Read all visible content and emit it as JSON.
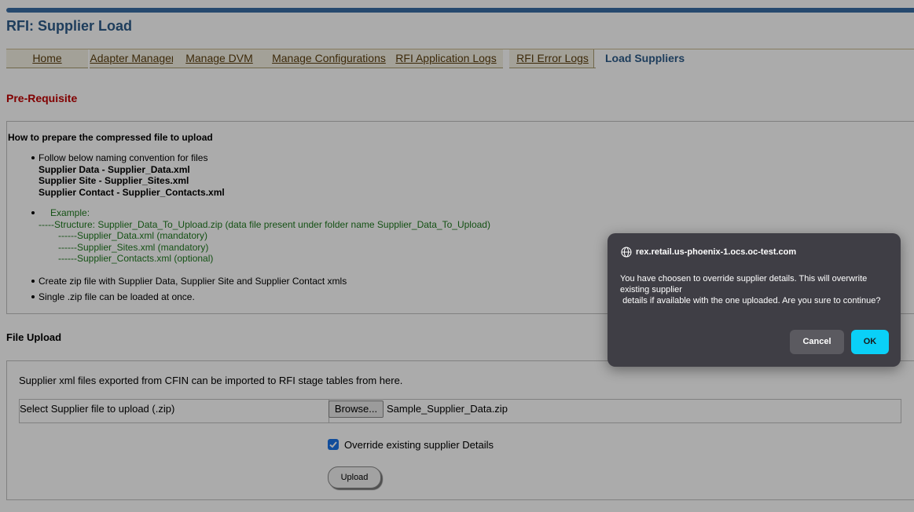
{
  "page": {
    "title": "RFI: Supplier Load"
  },
  "tabs": [
    {
      "label": "Home"
    },
    {
      "label": "Adapter Manager"
    },
    {
      "label": "Manage DVM"
    },
    {
      "label": "Manage Configurations"
    },
    {
      "label": "RFI Application Logs"
    },
    {
      "label": "RFI Error Logs"
    },
    {
      "label": "Load Suppliers",
      "active": true
    }
  ],
  "prereq": {
    "heading": "Pre-Requisite",
    "howto_title": "How to prepare the compressed file to upload",
    "naming_intro": "Follow below naming convention for files",
    "naming": [
      "Supplier Data - Supplier_Data.xml",
      "Supplier Site - Supplier_Sites.xml",
      "Supplier Contact - Supplier_Contacts.xml"
    ],
    "example_label": "Example:",
    "example_lines": [
      "-----Structure: Supplier_Data_To_Upload.zip (data file present under folder name Supplier_Data_To_Upload)",
      "------Supplier_Data.xml (mandatory)",
      "------Supplier_Sites.xml (mandatory)",
      "------Supplier_Contacts.xml (optional)"
    ],
    "bullet_zip": "Create zip file with Supplier Data, Supplier Site and Supplier Contact xmls",
    "bullet_single": "Single .zip file can be loaded at once."
  },
  "upload": {
    "heading": "File Upload",
    "intro": "Supplier xml files exported from CFIN can be imported to RFI stage tables from here.",
    "file_label": "Select Supplier file to upload (.zip)",
    "browse_label": "Browse...",
    "file_name": "Sample_Supplier_Data.zip",
    "override_label": "Override existing supplier Details",
    "override_checked": true,
    "upload_label": "Upload"
  },
  "dialog": {
    "host": "rex.retail.us-phoenix-1.ocs.oc-test.com",
    "message": "You have choosen to override supplier details. This will overwrite existing supplier\n details if available with the one uploaded. Are you sure to continue?",
    "cancel_label": "Cancel",
    "ok_label": "OK",
    "ok_color": "#0ad0f7"
  }
}
